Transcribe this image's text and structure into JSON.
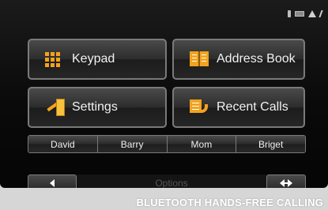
{
  "main": {
    "keypad_label": "Keypad",
    "address_book_label": "Address Book",
    "settings_label": "Settings",
    "recent_calls_label": "Recent Calls"
  },
  "contacts": [
    "David",
    "Barry",
    "Mom",
    "Briget"
  ],
  "footer": {
    "options_label": "Options"
  },
  "caption": "BLUETOOTH HANDS-FREE CALLING",
  "icons": {
    "keypad": "keypad-grid-icon",
    "address_book": "address-book-icon",
    "settings": "settings-icon",
    "recent_calls": "recent-calls-icon",
    "back": "left-arrow-icon",
    "swap": "swap-arrows-icon"
  },
  "colors": {
    "accent": "#f5a21c",
    "screen_bg": "#0a0a0a",
    "caption_bg": "#d6d6d6"
  }
}
